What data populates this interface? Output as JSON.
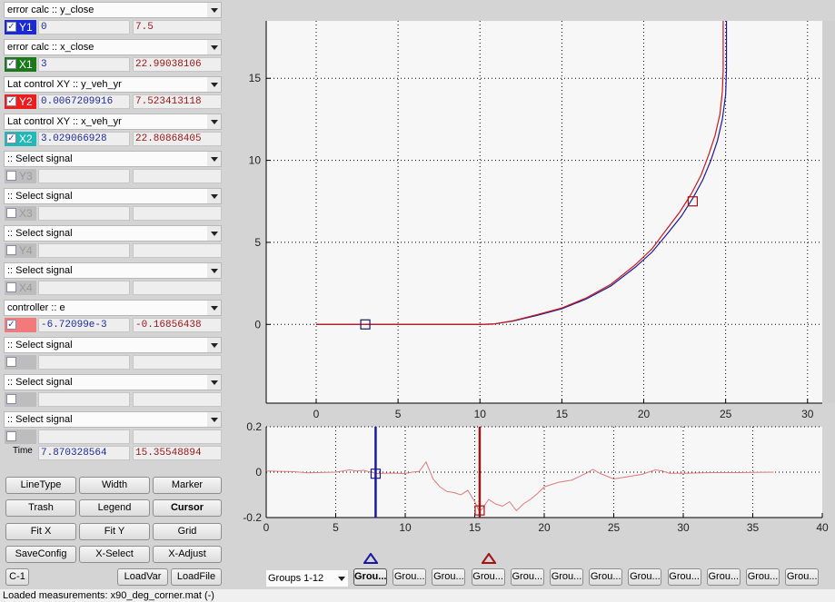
{
  "signals": [
    {
      "name": "error calc :: y_close",
      "tag": "Y1",
      "tag_color": "#1a2ad0",
      "checked": true,
      "value1": "0",
      "value2": "7.5"
    },
    {
      "name": "error calc :: x_close",
      "tag": "X1",
      "tag_color": "#1a7a1a",
      "checked": true,
      "value1": "3",
      "value2": "22.99038106"
    },
    {
      "name": "Lat control XY :: y_veh_yr",
      "tag": "Y2",
      "tag_color": "#ee1c1c",
      "checked": true,
      "value1": "0.0067209916",
      "value2": "7.523413118"
    },
    {
      "name": "Lat control XY :: x_veh_yr",
      "tag": "X2",
      "tag_color": "#22b8b8",
      "checked": true,
      "value1": "3.029066928",
      "value2": "22.80868405"
    },
    {
      "name": ":: Select signal",
      "tag": "Y3",
      "tag_color": "#bdbdbd",
      "checked": false,
      "value1": "",
      "value2": ""
    },
    {
      "name": ":: Select signal",
      "tag": "X3",
      "tag_color": "#bdbdbd",
      "checked": false,
      "value1": "",
      "value2": ""
    },
    {
      "name": ":: Select signal",
      "tag": "Y4",
      "tag_color": "#bdbdbd",
      "checked": false,
      "value1": "",
      "value2": ""
    },
    {
      "name": ":: Select signal",
      "tag": "X4",
      "tag_color": "#bdbdbd",
      "checked": false,
      "value1": "",
      "value2": ""
    },
    {
      "name": "controller :: e",
      "tag": "",
      "tag_color": "#f27a7a",
      "checked": true,
      "value1": "-6.72099e-3",
      "value2": "-0.16856438"
    },
    {
      "name": ":: Select signal",
      "tag": "",
      "tag_color": "#bdbdbd",
      "checked": false,
      "value1": "",
      "value2": ""
    },
    {
      "name": ":: Select signal",
      "tag": "",
      "tag_color": "#bdbdbd",
      "checked": false,
      "value1": "",
      "value2": ""
    },
    {
      "name": ":: Select signal",
      "tag": "",
      "tag_color": "#bdbdbd",
      "checked": false,
      "value1": "",
      "value2": ""
    }
  ],
  "time": {
    "label": "Time",
    "value1": "7.870328564",
    "value2": "15.35548894"
  },
  "buttons": {
    "linetype": "LineType",
    "width": "Width",
    "marker": "Marker",
    "trash": "Trash",
    "legend": "Legend",
    "cursor": "Cursor",
    "fitx": "Fit X",
    "fity": "Fit Y",
    "grid": "Grid",
    "saveconfig": "SaveConfig",
    "xselect": "X-Select",
    "xadjust": "X-Adjust",
    "c1": "C-1",
    "loadvar": "LoadVar",
    "loadfile": "LoadFile"
  },
  "groups": {
    "selector": "Groups 1-12",
    "buttons": [
      "Grou...",
      "Grou...",
      "Grou...",
      "Grou...",
      "Grou...",
      "Grou...",
      "Grou...",
      "Grou...",
      "Grou...",
      "Grou...",
      "Grou...",
      "Grou..."
    ],
    "active_index": 0,
    "cursor_markers": [
      {
        "group_index": 0,
        "color": "#1a1aa0"
      },
      {
        "group_index": 3,
        "color": "#a01414"
      }
    ]
  },
  "status": "Loaded measurements: x90_deg_corner.mat (-)",
  "chart_data": [
    {
      "type": "line",
      "title": "",
      "xlabel": "",
      "ylabel": "",
      "xlim": [
        -3.05,
        30.9
      ],
      "ylim": [
        -4.8,
        18.5
      ],
      "xticks": [
        0,
        5,
        10,
        15,
        20,
        25,
        30
      ],
      "yticks": [
        0,
        5,
        10,
        15
      ],
      "grid": true,
      "series": [
        {
          "name": "error calc (x_close, y_close)",
          "color": "#1a1aa0",
          "x": [
            0,
            10,
            10.8,
            12,
            13.5,
            15,
            16.5,
            18,
            19.5,
            20.5,
            21.5,
            22.3,
            23,
            23.6,
            24.1,
            24.5,
            24.8,
            25,
            25.05,
            25.05
          ],
          "y": [
            0,
            0,
            0.02,
            0.2,
            0.55,
            0.95,
            1.55,
            2.35,
            3.5,
            4.4,
            5.6,
            6.6,
            7.7,
            8.8,
            10,
            11.2,
            12.5,
            14,
            15.5,
            18.5
          ]
        },
        {
          "name": "Lat control XY (x_veh_yr, y_veh_yr)",
          "color": "#cc1a1a",
          "x": [
            0,
            10,
            10.8,
            12,
            13.5,
            15,
            16.5,
            18,
            19.5,
            20.5,
            21.4,
            22.2,
            22.9,
            23.5,
            23.95,
            24.35,
            24.65,
            24.8,
            24.85,
            24.85
          ],
          "y": [
            0,
            0,
            0.02,
            0.22,
            0.6,
            1.0,
            1.62,
            2.45,
            3.65,
            4.6,
            5.8,
            6.85,
            7.95,
            9.1,
            10.3,
            11.5,
            12.8,
            14.2,
            15.5,
            18.5
          ]
        }
      ],
      "cursor_markers": [
        {
          "x": 3,
          "y": 0,
          "color": "#1a1a6a"
        },
        {
          "x": 22.99,
          "y": 7.5,
          "color": "#a01414"
        }
      ]
    },
    {
      "type": "line",
      "title": "",
      "xlabel": "",
      "ylabel": "",
      "xlim": [
        0,
        40
      ],
      "ylim": [
        -0.2,
        0.2
      ],
      "xticks": [
        0,
        5,
        10,
        15,
        20,
        25,
        30,
        35,
        40
      ],
      "yticks": [
        -0.2,
        0,
        0.2
      ],
      "grid": true,
      "series": [
        {
          "name": "controller :: e",
          "color": "#e07a7a",
          "x": [
            0,
            2,
            3,
            5,
            6,
            6.5,
            7,
            7.5,
            8,
            9,
            10,
            10.5,
            11,
            11.5,
            12,
            12.5,
            13,
            13.5,
            14,
            14.5,
            15,
            15.3,
            15.5,
            16,
            16.5,
            17,
            17.5,
            18,
            18.5,
            19,
            19.5,
            20,
            21,
            22,
            23,
            23.5,
            24,
            25,
            26,
            27,
            28,
            28.5,
            29,
            30,
            32,
            34,
            36.5
          ],
          "y": [
            0.005,
            0.002,
            -0.003,
            0.0,
            0.01,
            0.005,
            0.008,
            0.0,
            -0.006,
            -0.004,
            -0.006,
            0.0,
            0.003,
            0.045,
            -0.03,
            -0.065,
            -0.085,
            -0.09,
            -0.1,
            -0.08,
            -0.13,
            -0.17,
            -0.165,
            -0.12,
            -0.14,
            -0.15,
            -0.13,
            -0.17,
            -0.14,
            -0.12,
            -0.095,
            -0.065,
            -0.045,
            -0.035,
            -0.005,
            0.012,
            -0.005,
            -0.03,
            -0.02,
            -0.01,
            0.01,
            0.005,
            -0.005,
            -0.005,
            -0.002,
            -0.002,
            0.0
          ]
        }
      ],
      "cursors": [
        {
          "time": 7.870328564,
          "value": -0.00672099,
          "color": "#1a1aa0"
        },
        {
          "time": 15.35548894,
          "value": -0.16856438,
          "color": "#a01414"
        }
      ]
    }
  ]
}
